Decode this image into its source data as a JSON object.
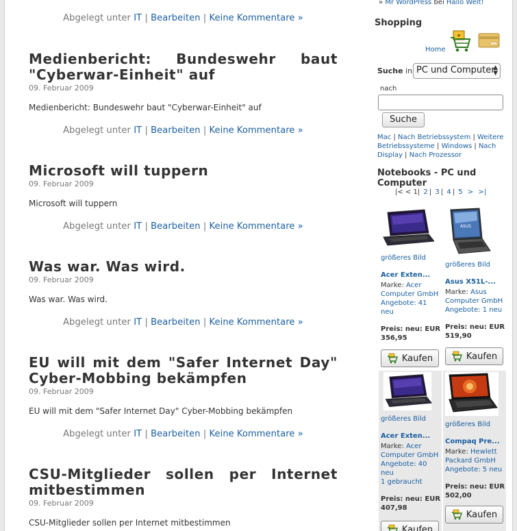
{
  "posts": [
    {
      "title": "",
      "date": "",
      "content": "",
      "meta": {
        "prefix": "Abgelegt unter",
        "category": "IT",
        "edit": "Bearbeiten",
        "comments": "Keine Kommentare »"
      }
    },
    {
      "title": "Medienbericht: Bundeswehr baut \"Cyberwar-Einheit\" auf",
      "date": "09. Februar 2009",
      "content": "Medienbericht: Bundeswehr baut \"Cyberwar-Einheit\" auf",
      "meta": {
        "prefix": "Abgelegt unter",
        "category": "IT",
        "edit": "Bearbeiten",
        "comments": "Keine Kommentare »"
      }
    },
    {
      "title": "Microsoft will tuppern",
      "date": "09. Februar 2009",
      "content": "Microsoft will tuppern",
      "meta": {
        "prefix": "Abgelegt unter",
        "category": "IT",
        "edit": "Bearbeiten",
        "comments": "Keine Kommentare »"
      }
    },
    {
      "title": "Was war. Was wird.",
      "date": "09. Februar 2009",
      "content": "Was war. Was wird.",
      "meta": {
        "prefix": "Abgelegt unter",
        "category": "IT",
        "edit": "Bearbeiten",
        "comments": "Keine Kommentare »"
      }
    },
    {
      "title": "EU will mit dem \"Safer Internet Day\" Cyber-Mobbing bekämpfen",
      "date": "09. Februar 2009",
      "content": "EU will mit dem \"Safer Internet Day\" Cyber-Mobbing bekämpfen",
      "meta": {
        "prefix": "Abgelegt unter",
        "category": "IT",
        "edit": "Bearbeiten",
        "comments": "Keine Kommentare »"
      }
    },
    {
      "title": "CSU-Mitglieder sollen per Internet mitbestimmen",
      "date": "09. Februar 2009",
      "content": "CSU-Mitglieder sollen per Internet mitbestimmen",
      "meta": {
        "prefix": "",
        "category": "",
        "edit": "",
        "comments": ""
      }
    }
  ],
  "sidebar": {
    "recent_comment": {
      "author": "Mr WordPress",
      "word": "bei",
      "post": "Hallo Welt!"
    },
    "shopping_title": "Shopping",
    "home_link": "Home",
    "search_label": "Suche",
    "search_in": "in",
    "search_select_value": "PC und Computer",
    "search_nach": "nach",
    "search_input_value": "",
    "search_button": "Suche",
    "categories": [
      "Mac",
      "Nach Betriebssystem",
      "Weitere Betriebssysteme",
      "Windows",
      "Nach Display",
      "Nach Prozessor"
    ],
    "notebooks_title": "Notebooks - PC und Computer",
    "pager": {
      "first": "|<",
      "prev": "<",
      "current": "1",
      "pages": [
        "2",
        "3",
        "4",
        "5"
      ],
      "next": ">",
      "last": ">|"
    },
    "products": [
      {
        "bigger": "größeres Bild",
        "name": "Acer Exten...",
        "brand_label": "Marke:",
        "brand": "Acer Computer GmbH",
        "offers": "Angebote: 41 neu",
        "offers_extra": "",
        "price_label": "Preis: neu: EUR",
        "price": "356,95",
        "buy": "Kaufen",
        "thumb": "acer-icon"
      },
      {
        "bigger": "größeres Bild",
        "name": "Asus X51L-...",
        "brand_label": "Marke:",
        "brand": "Asus Computer GmbH",
        "offers": "Angebote: 1 neu",
        "offers_extra": "",
        "price_label": "Preis: neu: EUR",
        "price": "519,90",
        "buy": "Kaufen",
        "thumb": "asus-icon"
      },
      {
        "bigger": "größeres Bild",
        "name": "Acer Exten...",
        "brand_label": "Marke:",
        "brand": "Acer Computer GmbH",
        "offers": "Angebote: 40 neu",
        "offers_extra": "1 gebraucht",
        "price_label": "Preis: neu: EUR",
        "price": "407,98",
        "buy": "Kaufen",
        "thumb": "acer-icon"
      },
      {
        "bigger": "größeres Bild",
        "name": "Compaq Pre...",
        "brand_label": "Marke:",
        "brand": "Hewlett Packard GmbH",
        "offers": "Angebote: 5 neu",
        "offers_extra": "",
        "price_label": "Preis: neu: EUR",
        "price": "502,00",
        "buy": "Kaufen",
        "thumb": "compaq-icon"
      }
    ]
  }
}
